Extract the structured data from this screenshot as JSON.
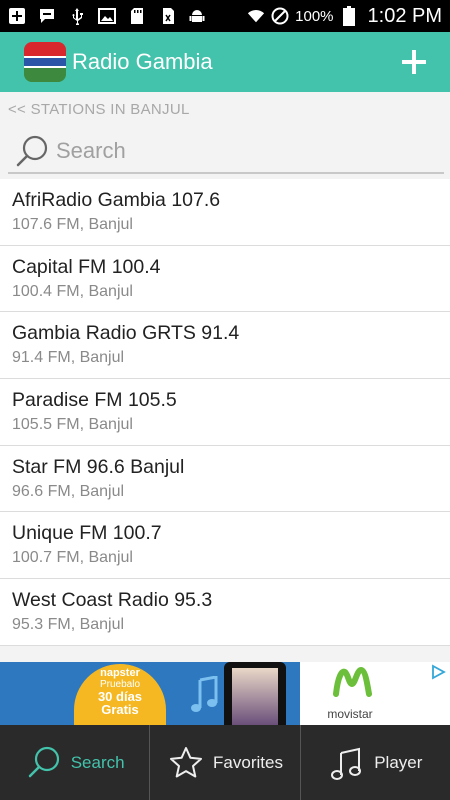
{
  "status_bar": {
    "battery_percent": "100%",
    "time": "1:02 PM",
    "icons": [
      "add-box-icon",
      "chat-icon",
      "usb-icon",
      "image-icon",
      "sd-card-icon",
      "sim-icon",
      "android-icon",
      "wifi-icon",
      "do-not-disturb-icon",
      "battery-icon"
    ]
  },
  "app_bar": {
    "title": "Radio Gambia",
    "flag_icon": "gambia-flag-icon",
    "add_icon": "plus-icon",
    "accent_color": "#43c3ab"
  },
  "breadcrumb": "<< STATIONS IN BANJUL",
  "search": {
    "placeholder": "Search",
    "value": ""
  },
  "stations": [
    {
      "name": "AfriRadio Gambia 107.6",
      "meta": "107.6 FM, Banjul"
    },
    {
      "name": "Capital FM 100.4",
      "meta": "100.4 FM, Banjul"
    },
    {
      "name": "Gambia Radio GRTS 91.4",
      "meta": "91.4 FM, Banjul"
    },
    {
      "name": "Paradise FM 105.5",
      "meta": "105.5 FM, Banjul"
    },
    {
      "name": "Star FM 96.6 Banjul",
      "meta": "96.6 FM, Banjul"
    },
    {
      "name": "Unique FM 100.7",
      "meta": "100.7 FM, Banjul"
    },
    {
      "name": "West Coast Radio 95.3",
      "meta": "95.3 FM, Banjul"
    }
  ],
  "ad": {
    "brand": "napster",
    "line1": "Pruebalo",
    "line2": "30 días",
    "line3": "Gratis",
    "advertiser": "movistar"
  },
  "tabs": [
    {
      "label": "Search",
      "icon": "search-icon",
      "active": true
    },
    {
      "label": "Favorites",
      "icon": "star-icon",
      "active": false
    },
    {
      "label": "Player",
      "icon": "music-note-icon",
      "active": false
    }
  ]
}
